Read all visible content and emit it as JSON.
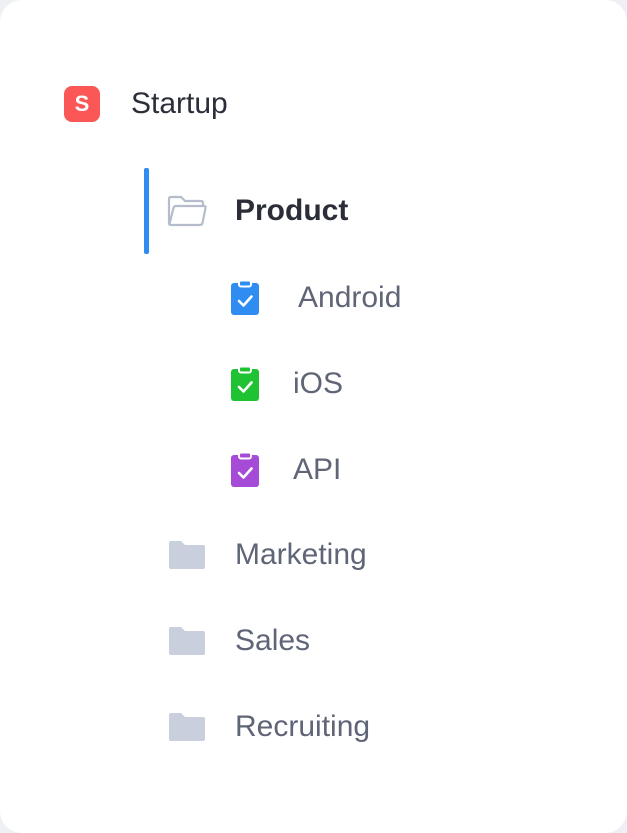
{
  "workspace": {
    "name": "Startup",
    "badge_letter": "S",
    "badge_color": "#fb5757"
  },
  "folders": [
    {
      "name": "Product",
      "active": true,
      "icon": "folder-open-icon",
      "children": [
        {
          "name": "Android",
          "icon": "clipboard-check-icon",
          "color": "#2f8cf0"
        },
        {
          "name": "iOS",
          "icon": "clipboard-check-icon",
          "color": "#1fc232"
        },
        {
          "name": "API",
          "icon": "clipboard-check-icon",
          "color": "#a64ad8"
        }
      ]
    },
    {
      "name": "Marketing",
      "active": false,
      "icon": "folder-icon"
    },
    {
      "name": "Sales",
      "active": false,
      "icon": "folder-icon"
    },
    {
      "name": "Recruiting",
      "active": false,
      "icon": "folder-icon"
    }
  ],
  "colors": {
    "accent": "#2f8cf0",
    "folder_fill": "#c9cfdc",
    "folder_outline": "#b5bccb",
    "text_primary": "#2b2e38",
    "text_secondary": "#5f6577"
  }
}
